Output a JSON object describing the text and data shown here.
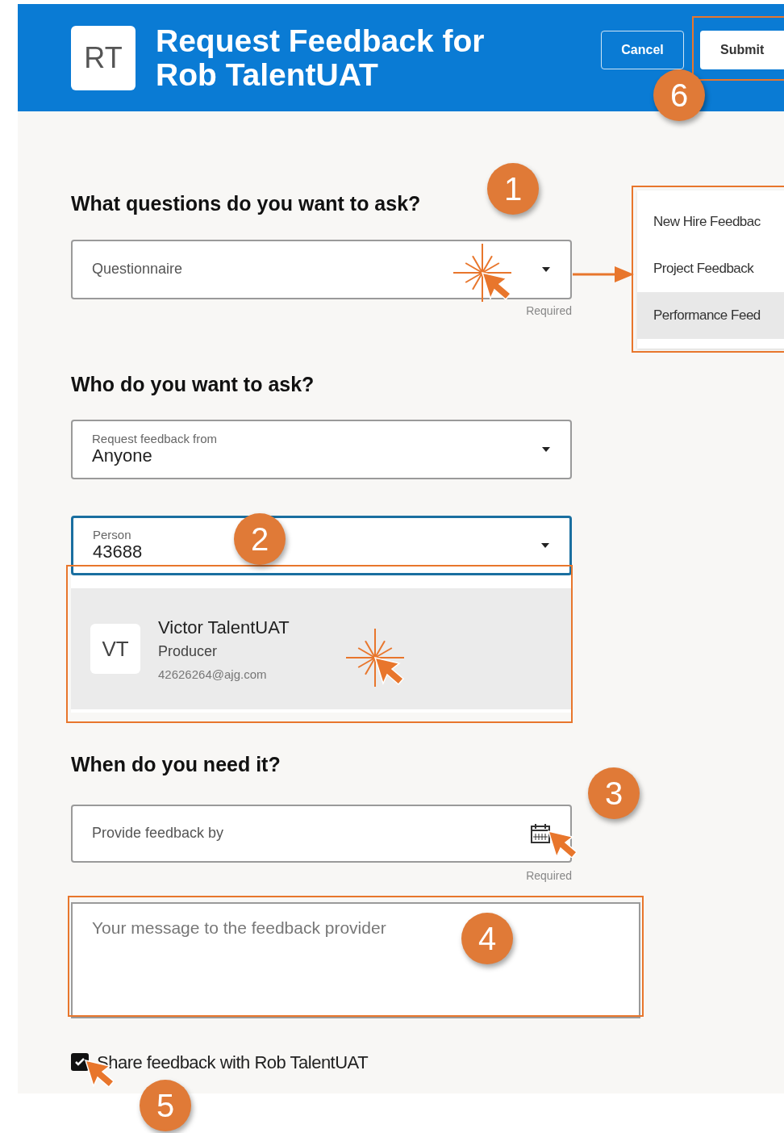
{
  "header": {
    "avatar": "RT",
    "title_lines": [
      "Request Feedback for",
      "Rob TalentUAT"
    ],
    "buttons": [
      {
        "label": "Cancel",
        "kind": "outline"
      },
      {
        "label": "Submit",
        "kind": "solid"
      }
    ]
  },
  "questions": {
    "heading": "What questions do you want to ask?",
    "field": {
      "placeholder": "Questionnaire"
    },
    "hint": "Required",
    "options": [
      {
        "label": "New Hire Feedbac",
        "selected": false
      },
      {
        "label": "Project Feedback",
        "selected": false
      },
      {
        "label": "Performance Feed",
        "selected": true
      }
    ]
  },
  "who": {
    "heading": "Who do you want to ask?",
    "request_from": {
      "label": "Request feedback from",
      "value": "Anyone"
    },
    "person": {
      "label": "Person",
      "value": "43688",
      "focused": true
    },
    "results": [
      {
        "initials": "VT",
        "name": "Victor TalentUAT",
        "title": "Producer",
        "email": "42626264@ajg.com",
        "selected": true
      }
    ]
  },
  "when": {
    "heading": "When do you need it?",
    "date": {
      "placeholder": "Provide feedback by"
    },
    "hint": "Required"
  },
  "message": {
    "placeholder": "Your message to the feedback provider"
  },
  "share": {
    "label": "Share feedback with Rob TalentUAT",
    "checked": true
  },
  "callouts": [
    "1",
    "2",
    "3",
    "4",
    "5",
    "6"
  ]
}
